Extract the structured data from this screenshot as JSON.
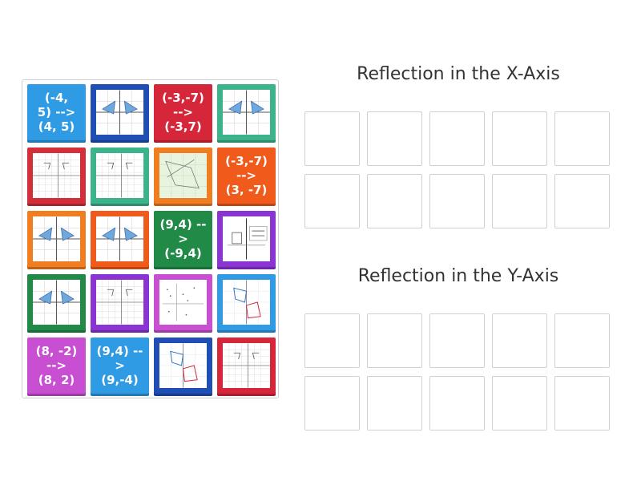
{
  "headings": {
    "x_axis": "Reflection in the X-Axis",
    "y_axis": "Reflection in the Y-Axis"
  },
  "tiles": [
    {
      "type": "text",
      "text": "(-4,\n5) -->\n(4, 5)",
      "color": "#2f9be5"
    },
    {
      "type": "image",
      "color": "#1f4fb5",
      "icon": "triangle-graph-image"
    },
    {
      "type": "text",
      "text": "(-3,-7)\n-->\n(-3,7)",
      "color": "#d6263a"
    },
    {
      "type": "image",
      "color": "#3cb38a",
      "icon": "triangle-graph-image"
    },
    {
      "type": "image",
      "color": "#d32f3a",
      "icon": "grid-graph-image"
    },
    {
      "type": "image",
      "color": "#3cb38a",
      "icon": "grid-graph-image"
    },
    {
      "type": "image",
      "color": "#f07d1f",
      "icon": "polygon-graph-image"
    },
    {
      "type": "text",
      "text": "(-3,-7)\n-->\n(3, -7)",
      "color": "#f05a1a"
    },
    {
      "type": "image",
      "color": "#f07d1f",
      "icon": "triangle-graph-image"
    },
    {
      "type": "image",
      "color": "#f05a1a",
      "icon": "triangle-graph-image"
    },
    {
      "type": "text",
      "text": "(9,4) -->\n(-9,4)",
      "color": "#218a47"
    },
    {
      "type": "image",
      "color": "#8a34d3",
      "icon": "line-of-reflection-image"
    },
    {
      "type": "image",
      "color": "#218a47",
      "icon": "triangle-graph-image"
    },
    {
      "type": "image",
      "color": "#8a34d3",
      "icon": "grid-graph-image"
    },
    {
      "type": "image",
      "color": "#c94fd2",
      "icon": "dots-graph-image"
    },
    {
      "type": "image",
      "color": "#2f9be5",
      "icon": "quadrilateral-graph-image"
    },
    {
      "type": "text",
      "text": "(8, -2)\n-->\n(8, 2)",
      "color": "#c94fd2"
    },
    {
      "type": "text",
      "text": "(9,4) -->\n(9,-4)",
      "color": "#2f9be5"
    },
    {
      "type": "image",
      "color": "#1f4fb5",
      "icon": "quadrilateral-graph-image"
    },
    {
      "type": "image",
      "color": "#d6263a",
      "icon": "grid-graph-image"
    }
  ]
}
